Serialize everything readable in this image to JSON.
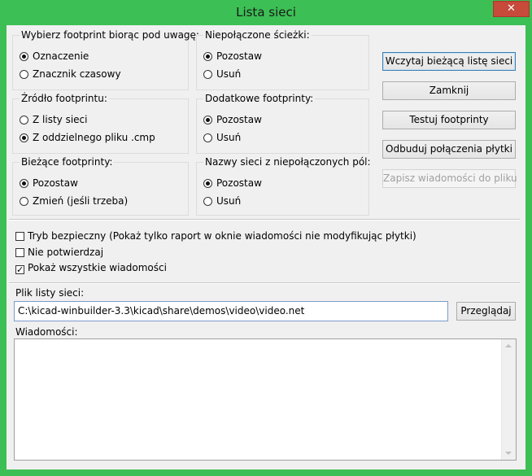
{
  "window": {
    "title": "Lista sieci",
    "close_glyph": "✕"
  },
  "groups": {
    "footprint_select": {
      "title": "Wybierz footprint biorąc pod uwagę:",
      "options": [
        "Oznaczenie",
        "Znacznik czasowy"
      ],
      "selected": 0
    },
    "footprint_source": {
      "title": "Źródło footprintu:",
      "options": [
        "Z listy sieci",
        "Z oddzielnego pliku .cmp"
      ],
      "selected": 1
    },
    "current_footprints": {
      "title": "Bieżące footprinty:",
      "options": [
        "Pozostaw",
        "Zmień (jeśli trzeba)"
      ],
      "selected": 0
    },
    "unconnected_tracks": {
      "title": "Niepołączone ścieżki:",
      "options": [
        "Pozostaw",
        "Usuń"
      ],
      "selected": 0
    },
    "extra_footprints": {
      "title": "Dodatkowe footprinty:",
      "options": [
        "Pozostaw",
        "Usuń"
      ],
      "selected": 0
    },
    "net_names_unconnected": {
      "title": "Nazwy sieci z niepołączonych pól:",
      "options": [
        "Pozostaw",
        "Usuń"
      ],
      "selected": 0
    }
  },
  "buttons": {
    "read_netlist": "Wczytaj bieżącą listę sieci",
    "close": "Zamknij",
    "test_footprints": "Testuj footprinty",
    "rebuild_connections": "Odbuduj połączenia płytki",
    "save_messages": "Zapisz wiadomości do pliku",
    "browse": "Przeglądaj"
  },
  "checkboxes": [
    {
      "label": "Tryb bezpieczny (Pokaż tylko raport w oknie wiadomości nie modyfikując płytki)",
      "checked": false
    },
    {
      "label": "Nie potwierdzaj",
      "checked": false
    },
    {
      "label": "Pokaż wszystkie wiadomości",
      "checked": true
    }
  ],
  "netlist_file": {
    "label": "Plik listy sieci:",
    "value": "C:\\kicad-winbuilder-3.3\\kicad\\share\\demos\\video\\video.net"
  },
  "messages": {
    "label": "Wiadomości:",
    "content": ""
  },
  "colors": {
    "title_bar": "#3cbf55",
    "close_button": "#c74a3b",
    "dialog_bg": "#f0f0f0"
  }
}
